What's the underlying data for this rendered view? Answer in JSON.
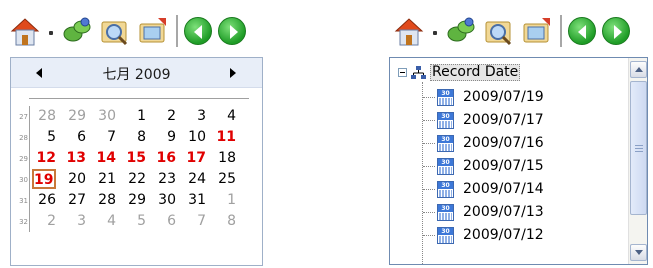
{
  "toolbar_icons": [
    "home-icon",
    "dropdown-dot",
    "connect-icon",
    "search-icon",
    "playback-icon",
    "prev-icon",
    "next-icon"
  ],
  "calendar": {
    "title": "七月 2009",
    "rows": [
      {
        "week": "27",
        "days": [
          {
            "d": "28",
            "kind": "other"
          },
          {
            "d": "29",
            "kind": "other"
          },
          {
            "d": "30",
            "kind": "other"
          },
          {
            "d": "1",
            "kind": "normal"
          },
          {
            "d": "2",
            "kind": "normal"
          },
          {
            "d": "3",
            "kind": "normal"
          },
          {
            "d": "4",
            "kind": "normal"
          }
        ]
      },
      {
        "week": "28",
        "days": [
          {
            "d": "5",
            "kind": "normal"
          },
          {
            "d": "6",
            "kind": "normal"
          },
          {
            "d": "7",
            "kind": "normal"
          },
          {
            "d": "8",
            "kind": "normal"
          },
          {
            "d": "9",
            "kind": "normal"
          },
          {
            "d": "10",
            "kind": "normal"
          },
          {
            "d": "11",
            "kind": "red"
          }
        ]
      },
      {
        "week": "29",
        "days": [
          {
            "d": "12",
            "kind": "red"
          },
          {
            "d": "13",
            "kind": "red"
          },
          {
            "d": "14",
            "kind": "red"
          },
          {
            "d": "15",
            "kind": "red"
          },
          {
            "d": "16",
            "kind": "red"
          },
          {
            "d": "17",
            "kind": "red"
          },
          {
            "d": "18",
            "kind": "normal"
          }
        ]
      },
      {
        "week": "30",
        "days": [
          {
            "d": "19",
            "kind": "today"
          },
          {
            "d": "20",
            "kind": "normal"
          },
          {
            "d": "21",
            "kind": "normal"
          },
          {
            "d": "22",
            "kind": "normal"
          },
          {
            "d": "23",
            "kind": "normal"
          },
          {
            "d": "24",
            "kind": "normal"
          },
          {
            "d": "25",
            "kind": "normal"
          }
        ]
      },
      {
        "week": "31",
        "days": [
          {
            "d": "26",
            "kind": "normal"
          },
          {
            "d": "27",
            "kind": "normal"
          },
          {
            "d": "28",
            "kind": "normal"
          },
          {
            "d": "29",
            "kind": "normal"
          },
          {
            "d": "30",
            "kind": "normal"
          },
          {
            "d": "31",
            "kind": "normal"
          },
          {
            "d": "1",
            "kind": "other"
          }
        ]
      },
      {
        "week": "32",
        "days": [
          {
            "d": "2",
            "kind": "other"
          },
          {
            "d": "3",
            "kind": "other"
          },
          {
            "d": "4",
            "kind": "other"
          },
          {
            "d": "5",
            "kind": "other"
          },
          {
            "d": "6",
            "kind": "other"
          },
          {
            "d": "7",
            "kind": "other"
          },
          {
            "d": "8",
            "kind": "other"
          }
        ]
      }
    ],
    "colors": {
      "red_day": "#e00000",
      "other_day": "#a0a0a0",
      "today_border": "#c9783a"
    }
  },
  "tree": {
    "root_label": "Record Date",
    "items": [
      "2009/07/19",
      "2009/07/17",
      "2009/07/16",
      "2009/07/15",
      "2009/07/14",
      "2009/07/13",
      "2009/07/12"
    ],
    "item_icon_text": "30"
  }
}
